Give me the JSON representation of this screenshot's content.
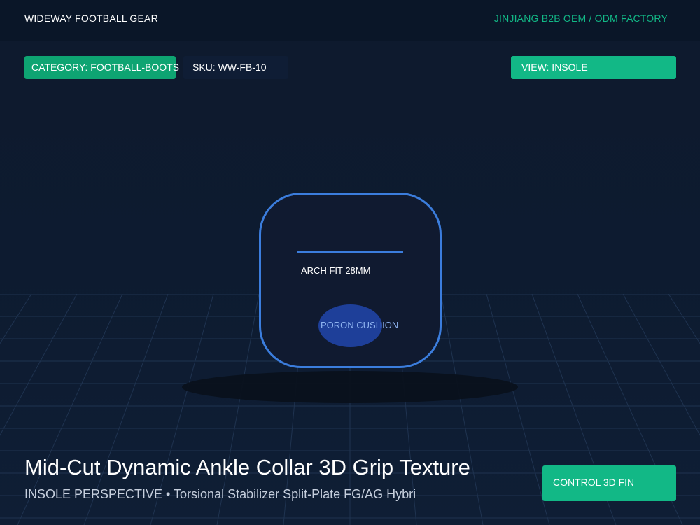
{
  "header": {
    "brand": "WIDEWAY FOOTBALL GEAR",
    "factory": "JINJIANG B2B OEM / ODM FACTORY"
  },
  "tags": {
    "category": "CATEGORY: FOOTBALL-BOOTS",
    "sku": "SKU: WW-FB-10",
    "view": "VIEW: INSOLE"
  },
  "viewer": {
    "arch_label": "ARCH FIT 28MM",
    "cushion_label": "PORON CUSHION"
  },
  "footer": {
    "title": "Mid-Cut Dynamic Ankle Collar 3D Grip Texture",
    "subtitle": "INSOLE PERSPECTIVE • Torsional Stabilizer Split-Plate FG/AG Hybri",
    "control_label": "CONTROL 3D FIN"
  },
  "colors": {
    "accent_green": "#12b886",
    "accent_blue": "#3b7ddd",
    "background": "#0e1a2d"
  }
}
